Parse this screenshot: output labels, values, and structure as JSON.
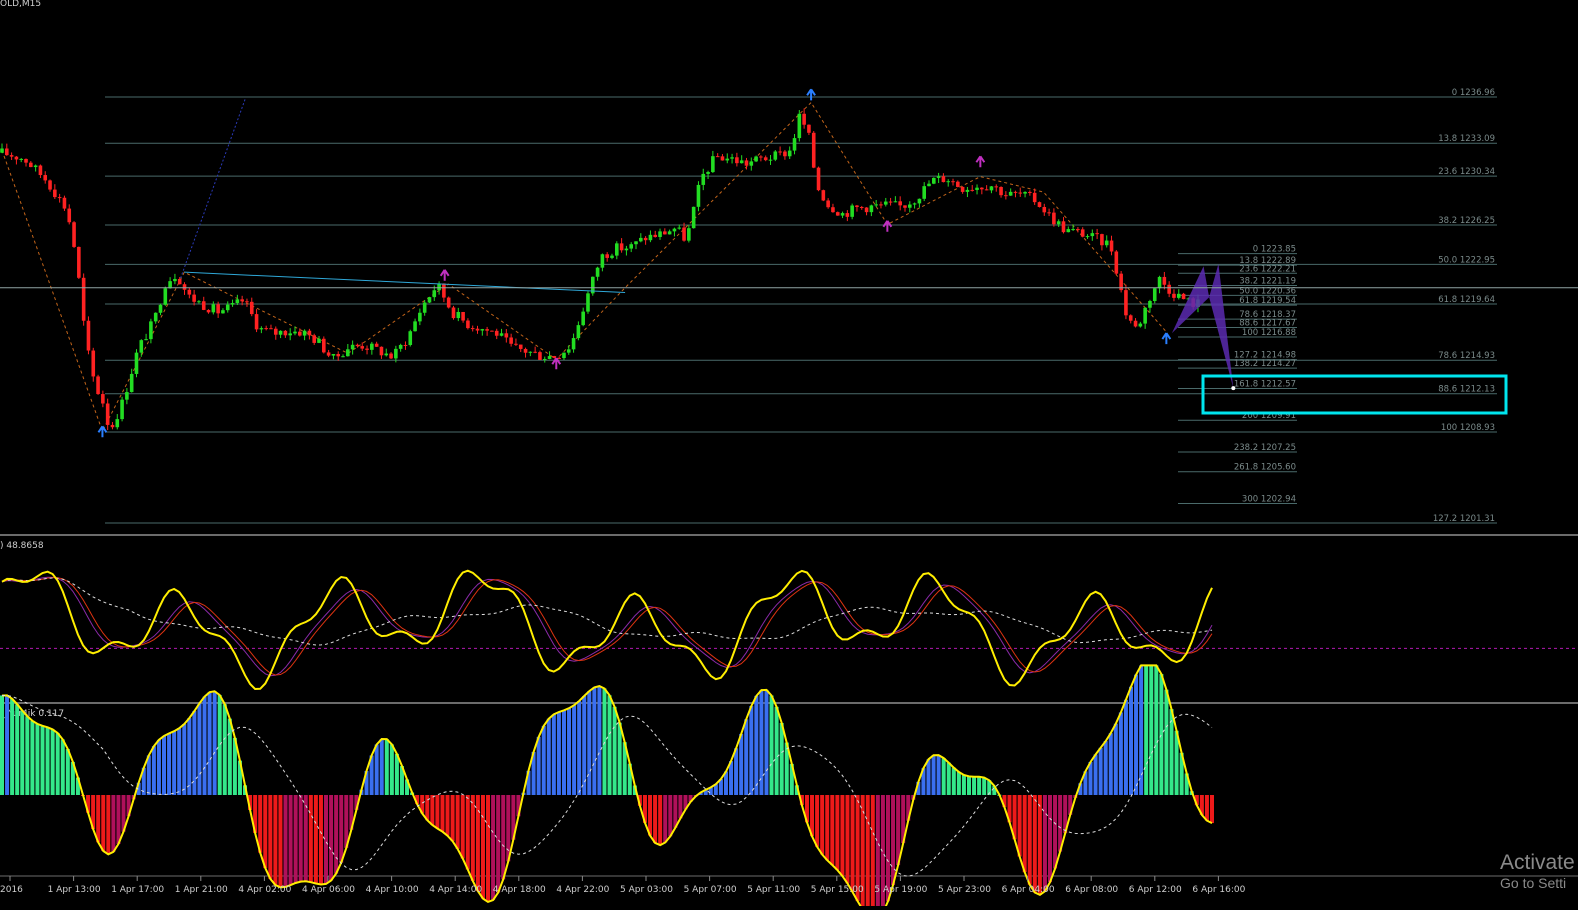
{
  "window": {
    "title": "OLD,M15",
    "osc1_label": ") 48.8658",
    "osc2_label": "r_Yur4ik 0.117"
  },
  "watermark": {
    "line1": "Activate",
    "line2": "Go to Setti"
  },
  "colors": {
    "background": "#000000",
    "bull": "#22dd22",
    "bear": "#ff2222",
    "fib_line": "#4a6a6a",
    "fib_text": "#7a8a8a",
    "trendline": "#2fa8d8",
    "highlight": "#00e5ee",
    "pattern": "#5a2ab0",
    "arrow_up": "#2a7fff",
    "arrow_down": "#c030c0",
    "osc_main": "#ffee00",
    "histo_pos": "#3a6ff0",
    "histo_pos_light": "#34e88a",
    "histo_neg": "#b0105a",
    "histo_neg_light": "#ee1a1a"
  },
  "chart_data": [
    {
      "type": "line",
      "name": "price",
      "x_ticks": [
        "2016",
        "1 Apr 13:00",
        "1 Apr 17:00",
        "1 Apr 21:00",
        "4 Apr 02:00",
        "4 Apr 06:00",
        "4 Apr 10:00",
        "4 Apr 14:00",
        "4 Apr 18:00",
        "4 Apr 22:00",
        "5 Apr 03:00",
        "5 Apr 07:00",
        "5 Apr 11:00",
        "5 Apr 15:00",
        "5 Apr 19:00",
        "5 Apr 23:00",
        "6 Apr 04:00",
        "6 Apr 08:00",
        "6 Apr 12:00",
        "6 Apr 16:00"
      ],
      "ylim": [
        1201.0,
        1238.5
      ],
      "path_points": [
        [
          0,
          1232.3
        ],
        [
          1.2,
          1231.8
        ],
        [
          2.4,
          1230.0
        ],
        [
          3.5,
          1227.5
        ],
        [
          4,
          1223.5
        ],
        [
          4.5,
          1216.5
        ],
        [
          5,
          1212.8
        ],
        [
          5.4,
          1211.6
        ],
        [
          5.8,
          1209.0
        ],
        [
          6.5,
          1211.5
        ],
        [
          7.3,
          1215.8
        ],
        [
          8.2,
          1218.3
        ],
        [
          8.8,
          1221.5
        ],
        [
          9.4,
          1222.2
        ],
        [
          10,
          1220.3
        ],
        [
          10.8,
          1219.6
        ],
        [
          11.6,
          1219.0
        ],
        [
          12.4,
          1219.4
        ],
        [
          13,
          1220.0
        ],
        [
          13.8,
          1217.6
        ],
        [
          14.6,
          1217.2
        ],
        [
          15.4,
          1217.4
        ],
        [
          16.2,
          1217.3
        ],
        [
          17,
          1216.5
        ],
        [
          17.8,
          1215.0
        ],
        [
          18.6,
          1216.0
        ],
        [
          19.4,
          1216.2
        ],
        [
          20.2,
          1215.8
        ],
        [
          21,
          1215.2
        ],
        [
          21.8,
          1216.8
        ],
        [
          22.6,
          1219.5
        ],
        [
          23.4,
          1221.3
        ],
        [
          24.2,
          1219.0
        ],
        [
          25,
          1218.0
        ],
        [
          25.8,
          1217.6
        ],
        [
          26.6,
          1217.2
        ],
        [
          27.4,
          1216.0
        ],
        [
          28.2,
          1215.7
        ],
        [
          29,
          1215.3
        ],
        [
          29.8,
          1215.3
        ],
        [
          30.6,
          1216.2
        ],
        [
          31.4,
          1220.0
        ],
        [
          32.2,
          1223.6
        ],
        [
          33,
          1224.3
        ],
        [
          33.8,
          1224.4
        ],
        [
          34.6,
          1225.2
        ],
        [
          35.4,
          1225.5
        ],
        [
          36.2,
          1226.0
        ],
        [
          36.8,
          1225.0
        ],
        [
          37.6,
          1230.2
        ],
        [
          38.4,
          1232.0
        ],
        [
          39.2,
          1231.8
        ],
        [
          40,
          1231.4
        ],
        [
          40.8,
          1231.8
        ],
        [
          41.6,
          1232.0
        ],
        [
          42.4,
          1232.5
        ],
        [
          42.9,
          1235.5
        ],
        [
          43.4,
          1233.5
        ],
        [
          43.8,
          1229.6
        ],
        [
          44.4,
          1228.0
        ],
        [
          45.2,
          1227.2
        ],
        [
          46,
          1227.7
        ],
        [
          46.8,
          1227.8
        ],
        [
          47.6,
          1227.9
        ],
        [
          48.4,
          1227.8
        ],
        [
          49.2,
          1228.6
        ],
        [
          50,
          1230.0
        ],
        [
          50.8,
          1230.2
        ],
        [
          51.6,
          1229.4
        ],
        [
          52.4,
          1229.5
        ],
        [
          53.2,
          1229.6
        ],
        [
          54,
          1228.8
        ],
        [
          54.8,
          1228.8
        ],
        [
          55.6,
          1228.3
        ],
        [
          56.4,
          1226.9
        ],
        [
          57.2,
          1225.8
        ],
        [
          58,
          1225.6
        ],
        [
          58.8,
          1225.1
        ],
        [
          59.6,
          1224.6
        ],
        [
          60,
          1222.0
        ],
        [
          60.4,
          1219.0
        ],
        [
          61,
          1217.5
        ],
        [
          61.6,
          1219.8
        ],
        [
          62.2,
          1221.8
        ],
        [
          62.8,
          1220.8
        ],
        [
          63.4,
          1220.2
        ],
        [
          63.9,
          1219.7
        ],
        [
          64.3,
          1219.7
        ]
      ]
    },
    {
      "type": "table",
      "name": "fibonacci_levels",
      "levels": [
        {
          "ratio": "0",
          "price": "1236.96"
        },
        {
          "ratio": "13.8",
          "price": "1233.09"
        },
        {
          "ratio": "23.6",
          "price": "1230.34"
        },
        {
          "ratio": "38.2",
          "price": "1226.25"
        },
        {
          "ratio": "50.0",
          "price": "1222.95"
        },
        {
          "ratio": "61.8",
          "price": "1219.64"
        },
        {
          "ratio": "78.6",
          "price": "1214.93"
        },
        {
          "ratio": "88.6",
          "price": "1212.13"
        },
        {
          "ratio": "100",
          "price": "1208.93"
        },
        {
          "ratio": "127.2",
          "price": "1201.31"
        }
      ],
      "inner_levels": [
        {
          "ratio": "0",
          "price": "1223.85"
        },
        {
          "ratio": "13.8",
          "price": "1222.89"
        },
        {
          "ratio": "23.6",
          "price": "1222.21"
        },
        {
          "ratio": "38.2",
          "price": "1221.19"
        },
        {
          "ratio": "50.0",
          "price": "1220.36"
        },
        {
          "ratio": "61.8",
          "price": "1219.54"
        },
        {
          "ratio": "78.6",
          "price": "1218.37"
        },
        {
          "ratio": "88.6",
          "price": "1217.67"
        },
        {
          "ratio": "100",
          "price": "1216.88"
        },
        {
          "ratio": "127.2",
          "price": "1214.98"
        },
        {
          "ratio": "138.2",
          "price": "1214.27"
        },
        {
          "ratio": "161.8",
          "price": "1212.57"
        },
        {
          "ratio": "200",
          "price": "1209.91"
        },
        {
          "ratio": "238.2",
          "price": "1207.25"
        },
        {
          "ratio": "261.8",
          "price": "1205.60"
        },
        {
          "ratio": "300",
          "price": "1202.94"
        }
      ]
    },
    {
      "type": "line",
      "name": "oscillator",
      "label": ") 48.8658",
      "ylim": [
        0,
        100
      ],
      "reference_level": 34
    },
    {
      "type": "bar",
      "name": "histogram",
      "label": "r_Yur4ik 0.117"
    }
  ]
}
